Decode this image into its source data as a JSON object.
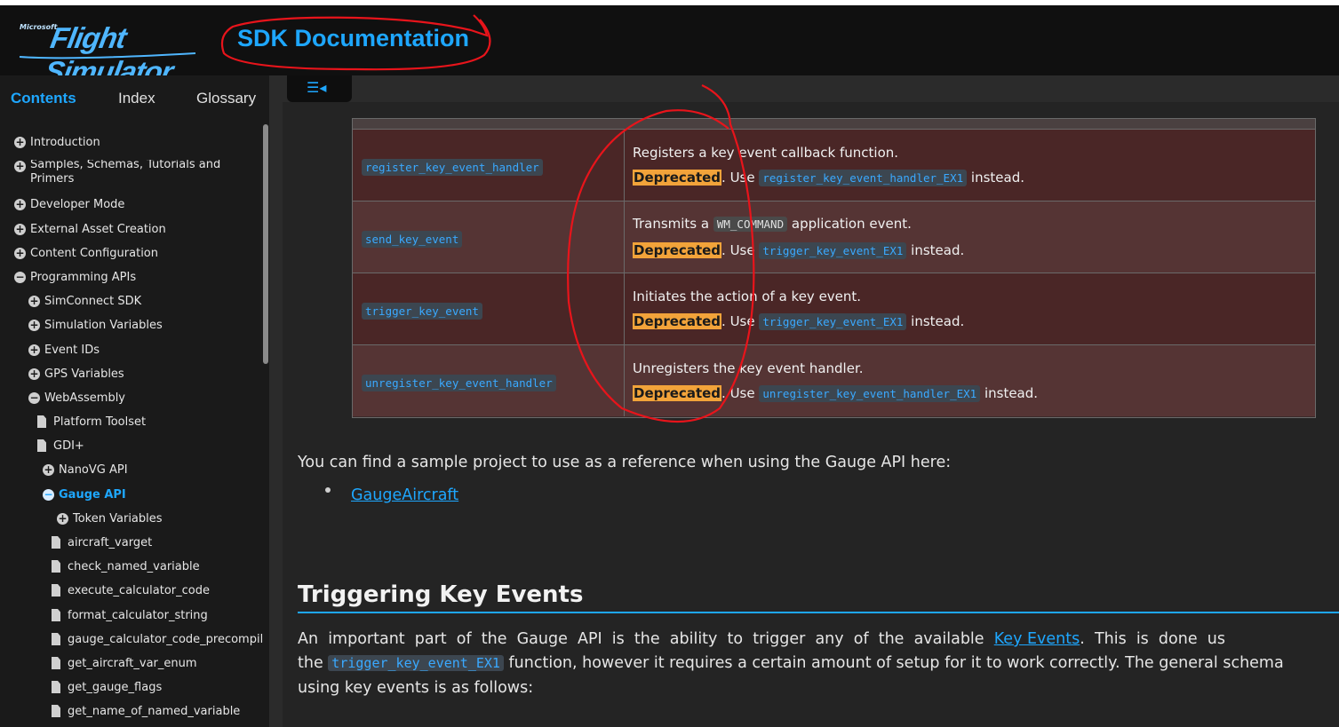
{
  "header": {
    "logo_ms": "Microsoft",
    "logo_text": "Flight Simulator",
    "title": "SDK Documentation"
  },
  "sidebar": {
    "tabs": [
      "Contents",
      "Index",
      "Glossary"
    ],
    "items": [
      {
        "label": "Introduction",
        "icon": "plus-circle-icon"
      },
      {
        "label": "Samples, Schemas, Tutorials and",
        "label2": "Primers",
        "icon": "plus-circle-icon"
      },
      {
        "label": "Developer Mode",
        "icon": "plus-circle-icon"
      },
      {
        "label": "External Asset Creation",
        "icon": "plus-circle-icon"
      },
      {
        "label": "Content Configuration",
        "icon": "plus-circle-icon"
      },
      {
        "label": "Programming APIs",
        "icon": "minus-circle-icon"
      },
      {
        "label": "SimConnect SDK",
        "icon": "plus-circle-icon"
      },
      {
        "label": "Simulation Variables",
        "icon": "plus-circle-icon"
      },
      {
        "label": "Event IDs",
        "icon": "plus-circle-icon"
      },
      {
        "label": "GPS Variables",
        "icon": "plus-circle-icon"
      },
      {
        "label": "WebAssembly",
        "icon": "minus-circle-icon"
      },
      {
        "label": "Platform Toolset",
        "icon": "document-icon"
      },
      {
        "label": "GDI+",
        "icon": "document-icon"
      },
      {
        "label": "NanoVG API",
        "icon": "plus-circle-icon"
      },
      {
        "label": "Gauge API",
        "icon": "minus-circle-icon"
      },
      {
        "label": "Token Variables",
        "icon": "plus-circle-icon"
      },
      {
        "label": "aircraft_varget",
        "icon": "document-icon"
      },
      {
        "label": "check_named_variable",
        "icon": "document-icon"
      },
      {
        "label": "execute_calculator_code",
        "icon": "document-icon"
      },
      {
        "label": "format_calculator_string",
        "icon": "document-icon"
      },
      {
        "label": "gauge_calculator_code_precompile",
        "icon": "document-icon"
      },
      {
        "label": "get_aircraft_var_enum",
        "icon": "document-icon"
      },
      {
        "label": "get_gauge_flags",
        "icon": "document-icon"
      },
      {
        "label": "get_name_of_named_variable",
        "icon": "document-icon"
      }
    ],
    "toggle_icon": "sidebar-toggle-icon"
  },
  "table": {
    "rows": [
      {
        "fn": "register_key_event_handler",
        "desc": "Registers a key event callback function.",
        "dep": "Deprecated",
        "use": ". Use ",
        "repl": "register_key_event_handler_EX1",
        "instead": " instead."
      },
      {
        "fn": "send_key_event",
        "desc_pre": "Transmits a ",
        "desc_code": "WM_COMMAND",
        "desc_post": " application event.",
        "dep": "Deprecated",
        "use": ". Use ",
        "repl": "trigger_key_event_EX1",
        "instead": " instead."
      },
      {
        "fn": "trigger_key_event",
        "desc": "Initiates the action of a key event.",
        "dep": "Deprecated",
        "use": ". Use ",
        "repl": "trigger_key_event_EX1",
        "instead": " instead."
      },
      {
        "fn": "unregister_key_event_handler",
        "desc": "Unregisters the key event handler.",
        "dep": "Deprecated",
        "use": ". Use ",
        "repl": "unregister_key_event_handler_EX1",
        "instead": " instead."
      }
    ]
  },
  "content": {
    "sample_text": "You can find a sample project to use as a reference when using the Gauge API here:",
    "sample_link": "GaugeAircraft",
    "heading": "Triggering Key Events",
    "p1_a": "An  important  part  of  the  Gauge  API  is  the  ability  to  trigger  any  of  the  available  ",
    "p1_link": "Key Events",
    "p1_b": ".  This  is  done  us",
    "p2_a": "the ",
    "p2_code": "trigger_key_event_EX1",
    "p2_b": " function, however it requires a certain amount of setup for it to work correctly. The general schema",
    "p3": "using key events is as follows:"
  },
  "colors": {
    "accent": "#1ea7ff",
    "deprecated": "#f2a33a",
    "annotation": "#e8141b"
  }
}
